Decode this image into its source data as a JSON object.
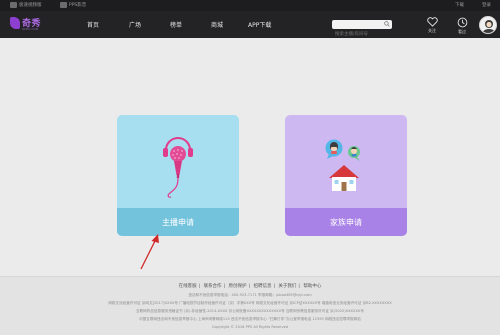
{
  "topbar": {
    "left_items": [
      "极速视频版",
      "PPS影音"
    ],
    "right_items": [
      "下载",
      "登录"
    ]
  },
  "nav": {
    "logo_text": "奇秀",
    "logo_sub": "QIXIU.COM",
    "items": [
      "首页",
      "广场",
      "榜单",
      "商城",
      "APP下载"
    ],
    "search_placeholder": "搜索主播/房间号",
    "icon_follow": "关注",
    "icon_history": "看过"
  },
  "cards": [
    {
      "label": "主播申请",
      "icon": "microphone-icon"
    },
    {
      "label": "家族申请",
      "icon": "house-family-icon"
    }
  ],
  "footer": {
    "links": [
      "在线客服",
      "联系合作",
      "原创保护",
      "招聘信息",
      "关于我们",
      "帮助中心"
    ],
    "lines": [
      "违法和不良信息举报电话：400-923-7171    举报邮箱：jubao365@qiyi.com",
      "网络文化经营许可证 京网文[2017]XXXX号  广播电视节目制作经营许可证（京）字第XXX号  网络文化经营许可证  京ICP证XXXXXX号  增值电信业务经营许可证 京B2-XXXXXXXX",
      "互联网药品信息服务资格证书 (京)-非经营性-2014-XXXX   京公网安备XXXXXXXXXXXXXX号   互联网宗教信息服务许可证 京(2020)XXXXXX号",
      "中国互联网违法和不良信息举报中心  上海市网警网络110  违法不良信息举报中心 “扫黄打非”办公室举报电话 12390  网络违法犯罪举报网站",
      "Copyright © 2016 PPS All Rights Reserved"
    ]
  }
}
